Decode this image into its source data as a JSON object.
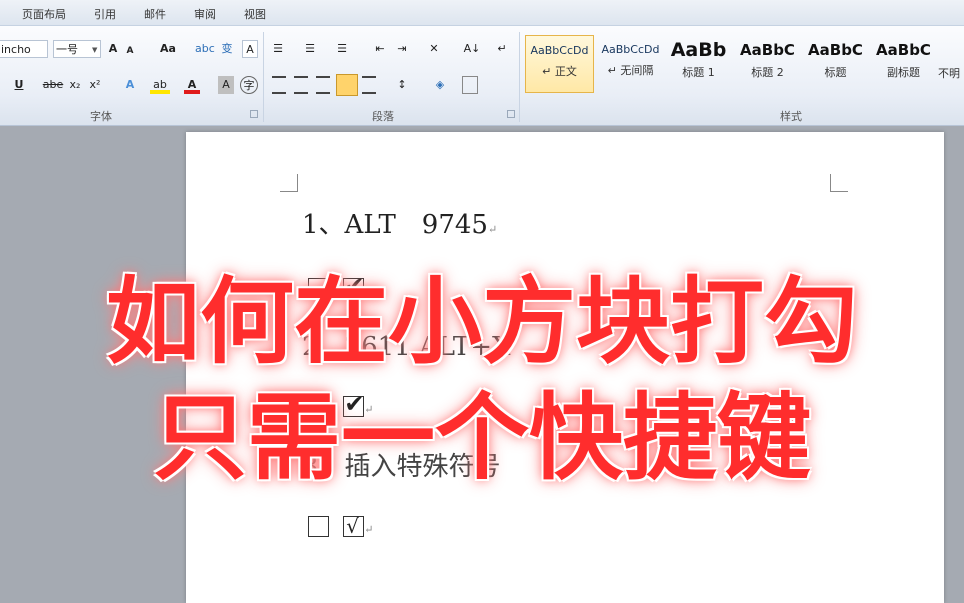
{
  "tabs": [
    "页面布局",
    "引用",
    "邮件",
    "审阅",
    "视图"
  ],
  "font_group": {
    "font_name": "incho",
    "font_size": "一号",
    "label": "字体",
    "grow_icon": "A",
    "shrink_icon": "A",
    "case_icon": "Aa",
    "clear_icon": "abc",
    "phonetic_icon": "变",
    "border_icon": "A",
    "underline": "U",
    "strike": "abe",
    "subscript": "x₂",
    "superscript": "x²",
    "effect_icon": "A",
    "highlight_icon": "ab",
    "color_icon": "A",
    "shade_icon": "A",
    "enclose_icon": "字"
  },
  "paragraph_group": {
    "label": "段落",
    "bullets": "☰",
    "numbering": "☰",
    "multilevel": "☰",
    "decrease_indent": "⇤",
    "increase_indent": "⇥",
    "chinese_layout": "✕",
    "sort": "A↓",
    "show_marks": "↵"
  },
  "styles_group": {
    "label": "样式",
    "items": [
      {
        "sample": "AaBbCcDd",
        "name": "↵ 正文"
      },
      {
        "sample": "AaBbCcDd",
        "name": "↵ 无间隔"
      },
      {
        "sample": "AaBb",
        "name": "标题 1"
      },
      {
        "sample": "AaBbC",
        "name": "标题 2"
      },
      {
        "sample": "AaBbC",
        "name": "标题"
      },
      {
        "sample": "AaBbC",
        "name": "副标题"
      },
      {
        "sample": "",
        "name": "不明"
      }
    ]
  },
  "document": {
    "line1": "1、ALT　9745",
    "line3": "2、2611 ALT+X",
    "line5": "3、插入特殊符号",
    "check_heavy": "✔",
    "check_light": "√",
    "para_mark": "↵"
  },
  "overlay": {
    "line1": "如何在小方块打勾",
    "line2": "只需一个快捷键"
  },
  "colors": {
    "overlay_text": "#ff2d2d",
    "ribbon_bg": "#e9eef6",
    "selected_style": "#ffe8a6"
  }
}
